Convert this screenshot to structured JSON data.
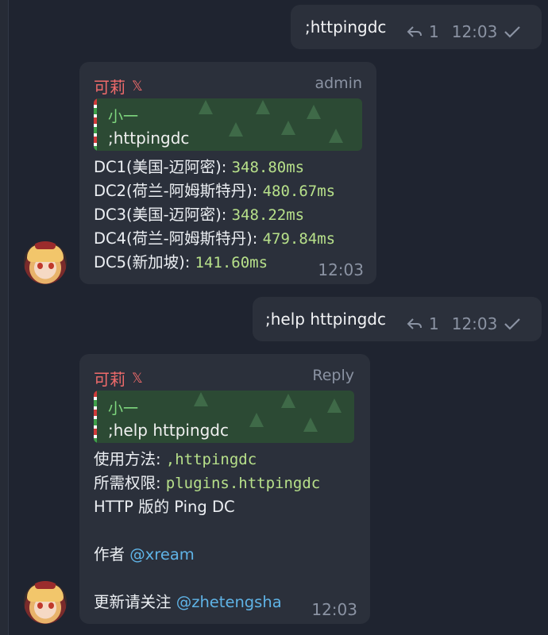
{
  "messages": [
    {
      "type": "out",
      "text": ";httpingdc",
      "replies": "1",
      "time": "12:03"
    },
    {
      "type": "in",
      "sender": "可莉",
      "sender_badge": "𝕏",
      "role": "admin",
      "quote": {
        "name": "小一",
        "text": ";httpingdc"
      },
      "lines": [
        {
          "label": "DC1(美国-迈阿密): ",
          "value": "348.80ms"
        },
        {
          "label": "DC2(荷兰-阿姆斯特丹): ",
          "value": "480.67ms"
        },
        {
          "label": "DC3(美国-迈阿密): ",
          "value": "348.22ms"
        },
        {
          "label": "DC4(荷兰-阿姆斯特丹): ",
          "value": "479.84ms"
        },
        {
          "label": "DC5(新加坡): ",
          "value": "141.60ms"
        }
      ],
      "time": "12:03"
    },
    {
      "type": "out",
      "text": ";help httpingdc",
      "replies": "1",
      "time": "12:03"
    },
    {
      "type": "in",
      "sender": "可莉",
      "sender_badge": "𝕏",
      "role": "Reply",
      "quote": {
        "name": "小一",
        "text": ";help httpingdc"
      },
      "usage_label": "使用方法: ",
      "usage_cmd": ",httpingdc",
      "perm_label": "所需权限: ",
      "perm_value": "plugins.httpingdc",
      "desc": "HTTP 版的 Ping DC",
      "author_label": "作者 ",
      "author_link": "@xream",
      "update_label": "更新请关注 ",
      "update_link": "@zhetengsha",
      "time": "12:03"
    }
  ],
  "icons": {
    "reply": "reply-arrow-icon",
    "check": "check-icon",
    "avatar": "avatar-image"
  },
  "colors": {
    "background": "#1f2430",
    "bubble": "#2b303b",
    "sender": "#f06b6b",
    "mono": "#b7e08a",
    "link": "#5fb3e6",
    "quote_bg": "#2c4a34"
  }
}
